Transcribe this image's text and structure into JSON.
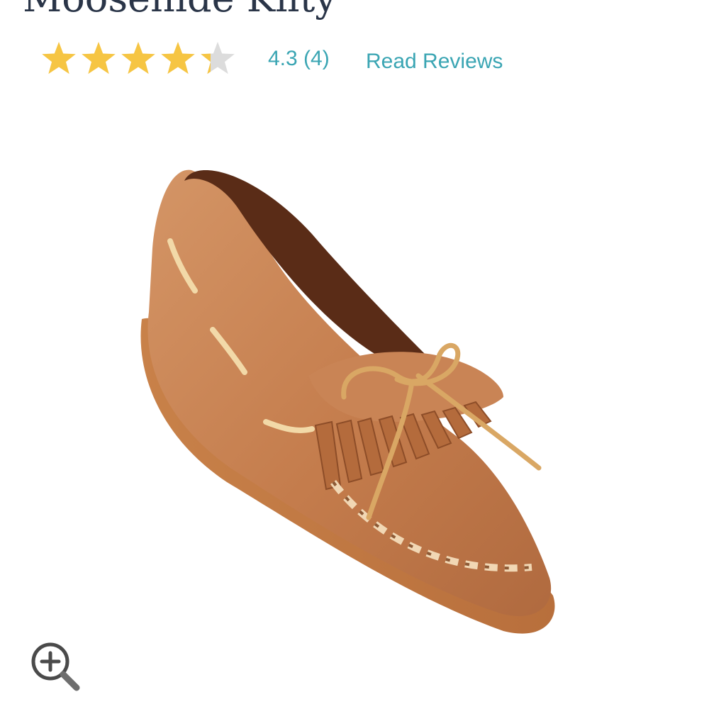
{
  "product": {
    "title": "Moosehide Kilty",
    "image_alt": "Moosehide Kilty moccasin"
  },
  "rating": {
    "value": 4.3,
    "max": 5,
    "text": "4.3 (4)",
    "read_reviews_label": "Read Reviews"
  },
  "icons": {
    "star_filled": "star-icon",
    "zoom": "zoom-in-icon"
  },
  "colors": {
    "title": "#2a3548",
    "star_filled": "#f6c543",
    "star_empty": "#dcdcdc",
    "link": "#3aa5b3"
  }
}
